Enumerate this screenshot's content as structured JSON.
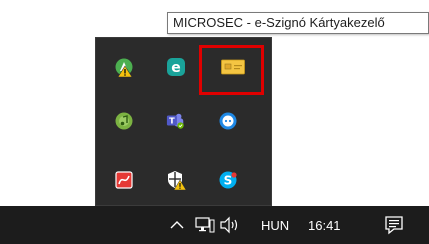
{
  "tooltip": {
    "text": "MICROSEC - e-Szignó Kártyakezelő"
  },
  "tray_flyout": {
    "highlight_color": "#e00000",
    "icons": [
      {
        "name": "avast-warning-icon",
        "color": "#4caf50"
      },
      {
        "name": "eset-icon",
        "color": "#1aa39a"
      },
      {
        "name": "e-szigno-card-manager-icon",
        "color": "#f4c542"
      },
      {
        "name": "music-app-icon",
        "color": "#7cb342"
      },
      {
        "name": "microsoft-teams-icon",
        "color": "#5059c9"
      },
      {
        "name": "chat-bubble-icon",
        "color": "#1e88e5"
      },
      {
        "name": "pdf-signer-icon",
        "color": "#e53935"
      },
      {
        "name": "security-shield-warning-icon",
        "color": "#ffffff"
      },
      {
        "name": "skype-icon",
        "color": "#00aff0"
      }
    ]
  },
  "taskbar": {
    "show_hidden_icons": "^",
    "language": "HUN",
    "clock": "16:41",
    "background": "#1c1c1c"
  }
}
